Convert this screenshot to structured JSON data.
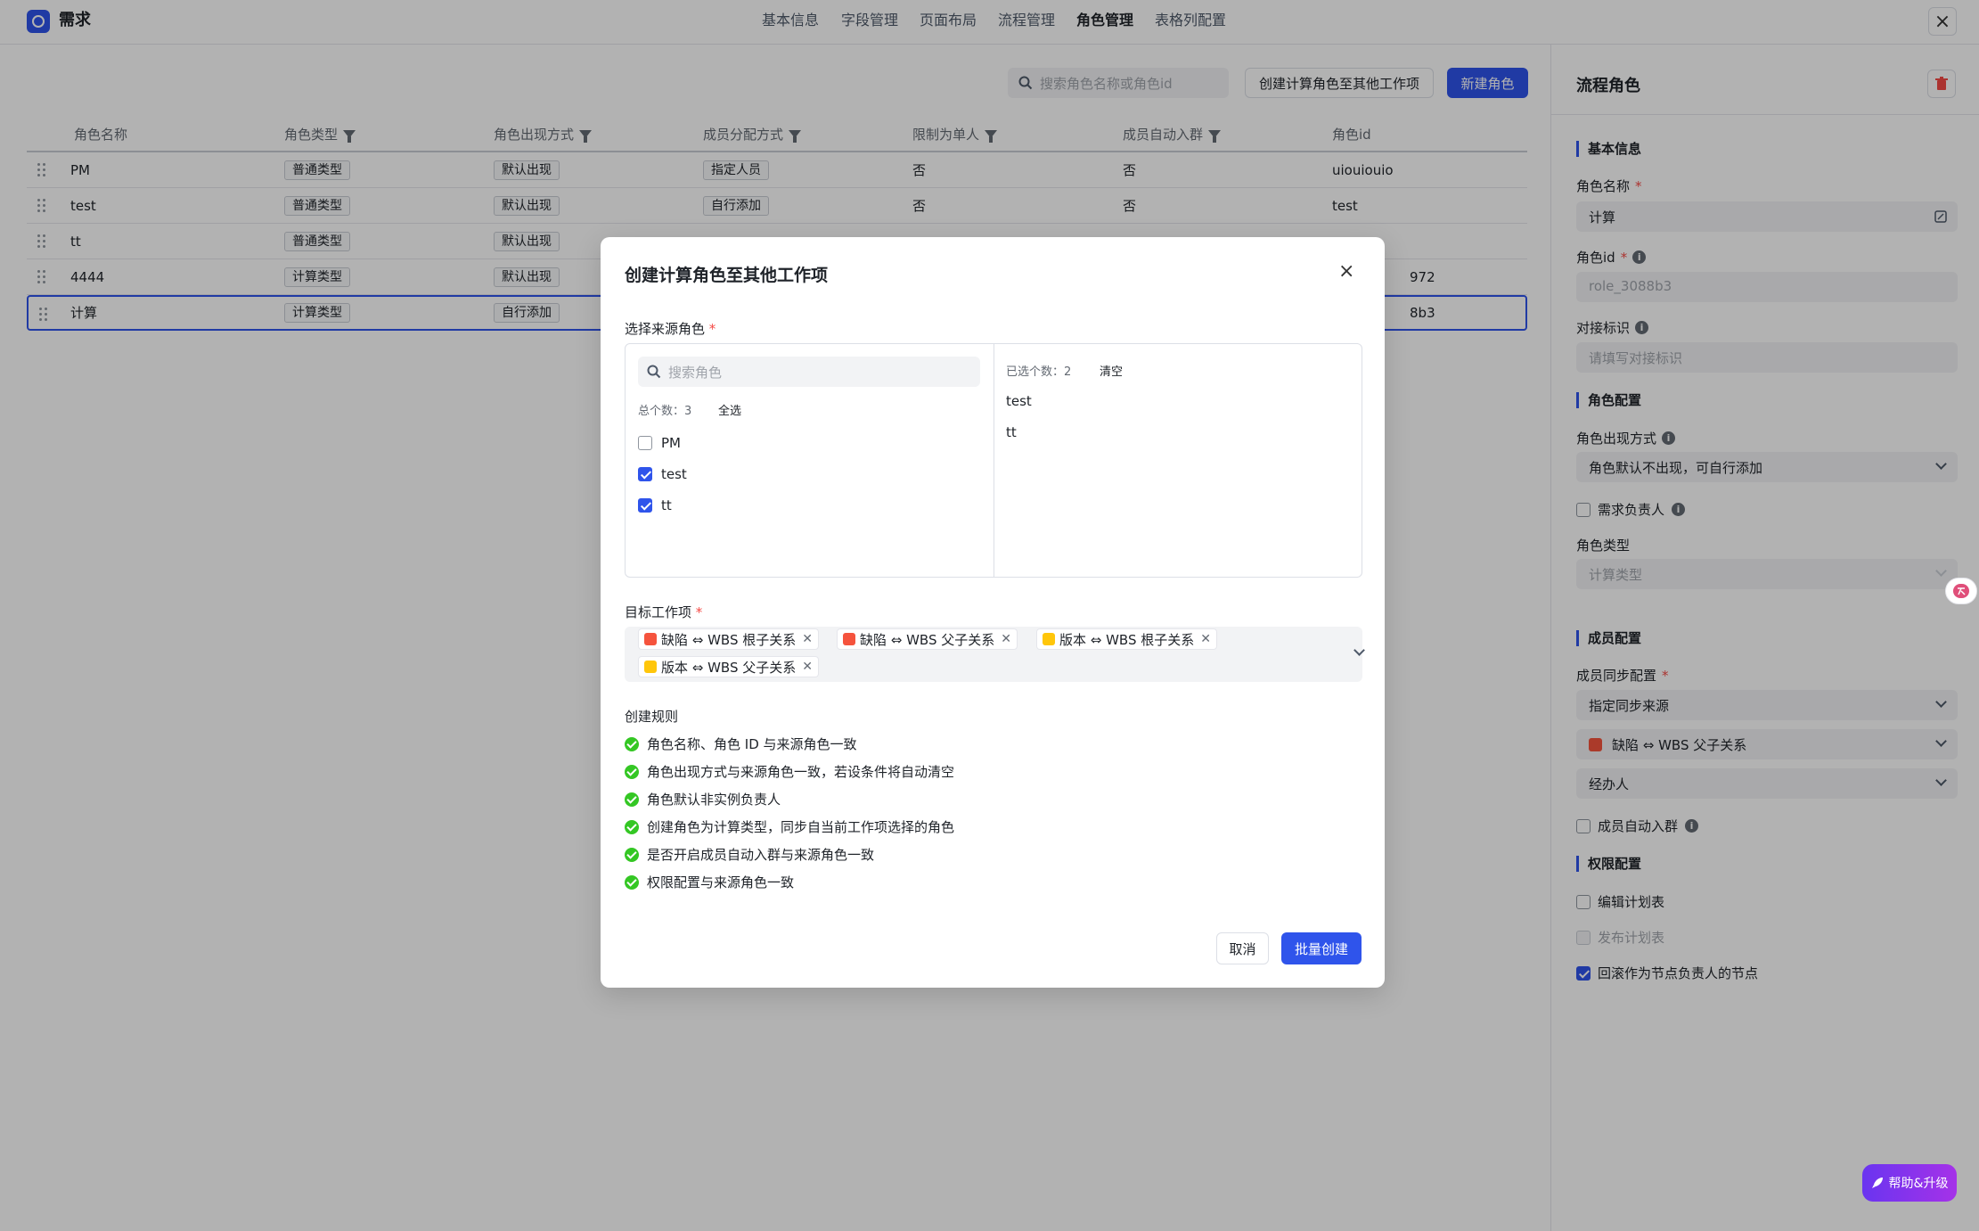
{
  "header": {
    "title": "需求",
    "tabs": [
      "基本信息",
      "字段管理",
      "页面布局",
      "流程管理",
      "角色管理",
      "表格列配置"
    ],
    "active_tab": "角色管理",
    "close_icon": "close-icon"
  },
  "toolbar": {
    "search_placeholder": "搜索角色名称或角色id",
    "copy_button": "创建计算角色至其他工作项",
    "new_button": "新建角色"
  },
  "table": {
    "columns": [
      "角色名称",
      "角色类型",
      "角色出现方式",
      "成员分配方式",
      "限制为单人",
      "成员自动入群",
      "角色id"
    ],
    "rows": [
      {
        "name": "PM",
        "type": "普通类型",
        "appear": "默认出现",
        "assign": "指定人员",
        "single": "否",
        "autogroup": "否",
        "id": "uiouiouio"
      },
      {
        "name": "test",
        "type": "普通类型",
        "appear": "默认出现",
        "assign": "自行添加",
        "single": "否",
        "autogroup": "否",
        "id": "test"
      },
      {
        "name": "tt",
        "type": "普通类型",
        "appear": "默认出现",
        "assign": "",
        "single": "",
        "autogroup": "",
        "id": ""
      },
      {
        "name": "4444",
        "type": "计算类型",
        "appear": "默认出现",
        "assign": "",
        "single": "",
        "autogroup": "",
        "id": "972"
      },
      {
        "name": "计算",
        "type": "计算类型",
        "appear": "自行添加",
        "assign": "",
        "single": "",
        "autogroup": "",
        "id": "8b3"
      }
    ]
  },
  "panel": {
    "title": "流程角色",
    "sec_basic": "基本信息",
    "name_label": "角色名称",
    "name_value": "计算",
    "id_label": "角色id",
    "id_value": "role_3088b3",
    "dock_label": "对接标识",
    "dock_placeholder": "请填写对接标识",
    "sec_role": "角色配置",
    "appear_label": "角色出现方式",
    "appear_value": "角色默认不出现，可自行添加",
    "owner_check": "需求负责人",
    "type_label": "角色类型",
    "type_value": "计算类型",
    "sec_member": "成员配置",
    "sync_label": "成员同步配置",
    "sync_value": "指定同步来源",
    "sync_source": "缺陷 ⇔ WBS 父子关系",
    "sync_field": "经办人",
    "autogroup_check": "成员自动入群",
    "sec_perm": "权限配置",
    "perm_edit": "编辑计划表",
    "perm_publish": "发布计划表",
    "perm_rollback": "回滚作为节点负责人的节点"
  },
  "help": {
    "label": "帮助&升级"
  },
  "modal": {
    "title": "创建计算角色至其他工作项",
    "src_label": "选择来源角色",
    "search_placeholder": "搜索角色",
    "total_label": "总个数：3",
    "select_all": "全选",
    "options": [
      {
        "label": "PM",
        "checked": false
      },
      {
        "label": "test",
        "checked": true
      },
      {
        "label": "tt",
        "checked": true
      }
    ],
    "selected_label": "已选个数：2",
    "clear": "清空",
    "selected": [
      "test",
      "tt"
    ],
    "target_label": "目标工作项",
    "targets": [
      {
        "label": "缺陷 ⇔ WBS 根子关系",
        "color": "#f5533d"
      },
      {
        "label": "缺陷 ⇔ WBS 父子关系",
        "color": "#f5533d"
      },
      {
        "label": "版本 ⇔ WBS 根子关系",
        "color": "#ffc60a"
      },
      {
        "label": "版本 ⇔ WBS 父子关系",
        "color": "#ffc60a"
      }
    ],
    "rules_label": "创建规则",
    "rules": [
      "角色名称、角色 ID 与来源角色一致",
      "角色出现方式与来源角色一致，若设条件将自动清空",
      "角色默认非实例负责人",
      "创建角色为计算类型，同步自当前工作项选择的角色",
      "是否开启成员自动入群与来源角色一致",
      "权限配置与来源角色一致"
    ],
    "cancel": "取消",
    "submit": "批量创建"
  },
  "colors": {
    "accent": "#2f54eb",
    "danger": "#f54a45",
    "success": "#34c724"
  }
}
